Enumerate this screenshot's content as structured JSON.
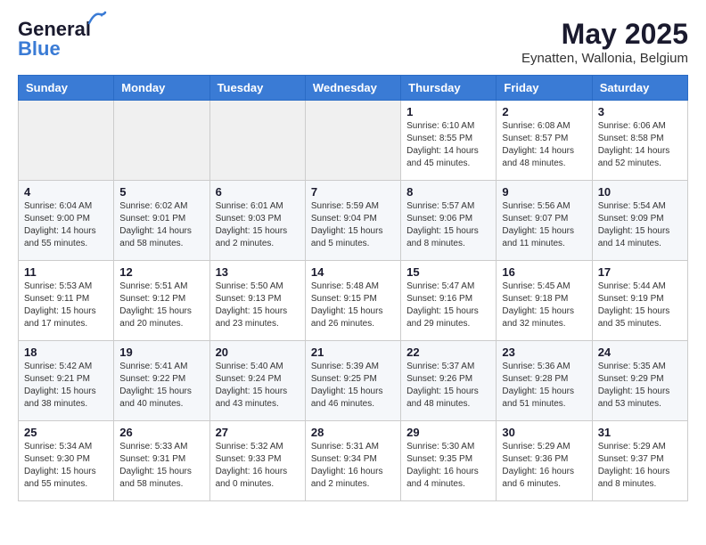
{
  "header": {
    "logo_general": "General",
    "logo_blue": "Blue",
    "month_year": "May 2025",
    "location": "Eynatten, Wallonia, Belgium"
  },
  "weekdays": [
    "Sunday",
    "Monday",
    "Tuesday",
    "Wednesday",
    "Thursday",
    "Friday",
    "Saturday"
  ],
  "weeks": [
    [
      {
        "day": "",
        "info": ""
      },
      {
        "day": "",
        "info": ""
      },
      {
        "day": "",
        "info": ""
      },
      {
        "day": "",
        "info": ""
      },
      {
        "day": "1",
        "info": "Sunrise: 6:10 AM\nSunset: 8:55 PM\nDaylight: 14 hours\nand 45 minutes."
      },
      {
        "day": "2",
        "info": "Sunrise: 6:08 AM\nSunset: 8:57 PM\nDaylight: 14 hours\nand 48 minutes."
      },
      {
        "day": "3",
        "info": "Sunrise: 6:06 AM\nSunset: 8:58 PM\nDaylight: 14 hours\nand 52 minutes."
      }
    ],
    [
      {
        "day": "4",
        "info": "Sunrise: 6:04 AM\nSunset: 9:00 PM\nDaylight: 14 hours\nand 55 minutes."
      },
      {
        "day": "5",
        "info": "Sunrise: 6:02 AM\nSunset: 9:01 PM\nDaylight: 14 hours\nand 58 minutes."
      },
      {
        "day": "6",
        "info": "Sunrise: 6:01 AM\nSunset: 9:03 PM\nDaylight: 15 hours\nand 2 minutes."
      },
      {
        "day": "7",
        "info": "Sunrise: 5:59 AM\nSunset: 9:04 PM\nDaylight: 15 hours\nand 5 minutes."
      },
      {
        "day": "8",
        "info": "Sunrise: 5:57 AM\nSunset: 9:06 PM\nDaylight: 15 hours\nand 8 minutes."
      },
      {
        "day": "9",
        "info": "Sunrise: 5:56 AM\nSunset: 9:07 PM\nDaylight: 15 hours\nand 11 minutes."
      },
      {
        "day": "10",
        "info": "Sunrise: 5:54 AM\nSunset: 9:09 PM\nDaylight: 15 hours\nand 14 minutes."
      }
    ],
    [
      {
        "day": "11",
        "info": "Sunrise: 5:53 AM\nSunset: 9:11 PM\nDaylight: 15 hours\nand 17 minutes."
      },
      {
        "day": "12",
        "info": "Sunrise: 5:51 AM\nSunset: 9:12 PM\nDaylight: 15 hours\nand 20 minutes."
      },
      {
        "day": "13",
        "info": "Sunrise: 5:50 AM\nSunset: 9:13 PM\nDaylight: 15 hours\nand 23 minutes."
      },
      {
        "day": "14",
        "info": "Sunrise: 5:48 AM\nSunset: 9:15 PM\nDaylight: 15 hours\nand 26 minutes."
      },
      {
        "day": "15",
        "info": "Sunrise: 5:47 AM\nSunset: 9:16 PM\nDaylight: 15 hours\nand 29 minutes."
      },
      {
        "day": "16",
        "info": "Sunrise: 5:45 AM\nSunset: 9:18 PM\nDaylight: 15 hours\nand 32 minutes."
      },
      {
        "day": "17",
        "info": "Sunrise: 5:44 AM\nSunset: 9:19 PM\nDaylight: 15 hours\nand 35 minutes."
      }
    ],
    [
      {
        "day": "18",
        "info": "Sunrise: 5:42 AM\nSunset: 9:21 PM\nDaylight: 15 hours\nand 38 minutes."
      },
      {
        "day": "19",
        "info": "Sunrise: 5:41 AM\nSunset: 9:22 PM\nDaylight: 15 hours\nand 40 minutes."
      },
      {
        "day": "20",
        "info": "Sunrise: 5:40 AM\nSunset: 9:24 PM\nDaylight: 15 hours\nand 43 minutes."
      },
      {
        "day": "21",
        "info": "Sunrise: 5:39 AM\nSunset: 9:25 PM\nDaylight: 15 hours\nand 46 minutes."
      },
      {
        "day": "22",
        "info": "Sunrise: 5:37 AM\nSunset: 9:26 PM\nDaylight: 15 hours\nand 48 minutes."
      },
      {
        "day": "23",
        "info": "Sunrise: 5:36 AM\nSunset: 9:28 PM\nDaylight: 15 hours\nand 51 minutes."
      },
      {
        "day": "24",
        "info": "Sunrise: 5:35 AM\nSunset: 9:29 PM\nDaylight: 15 hours\nand 53 minutes."
      }
    ],
    [
      {
        "day": "25",
        "info": "Sunrise: 5:34 AM\nSunset: 9:30 PM\nDaylight: 15 hours\nand 55 minutes."
      },
      {
        "day": "26",
        "info": "Sunrise: 5:33 AM\nSunset: 9:31 PM\nDaylight: 15 hours\nand 58 minutes."
      },
      {
        "day": "27",
        "info": "Sunrise: 5:32 AM\nSunset: 9:33 PM\nDaylight: 16 hours\nand 0 minutes."
      },
      {
        "day": "28",
        "info": "Sunrise: 5:31 AM\nSunset: 9:34 PM\nDaylight: 16 hours\nand 2 minutes."
      },
      {
        "day": "29",
        "info": "Sunrise: 5:30 AM\nSunset: 9:35 PM\nDaylight: 16 hours\nand 4 minutes."
      },
      {
        "day": "30",
        "info": "Sunrise: 5:29 AM\nSunset: 9:36 PM\nDaylight: 16 hours\nand 6 minutes."
      },
      {
        "day": "31",
        "info": "Sunrise: 5:29 AM\nSunset: 9:37 PM\nDaylight: 16 hours\nand 8 minutes."
      }
    ]
  ]
}
